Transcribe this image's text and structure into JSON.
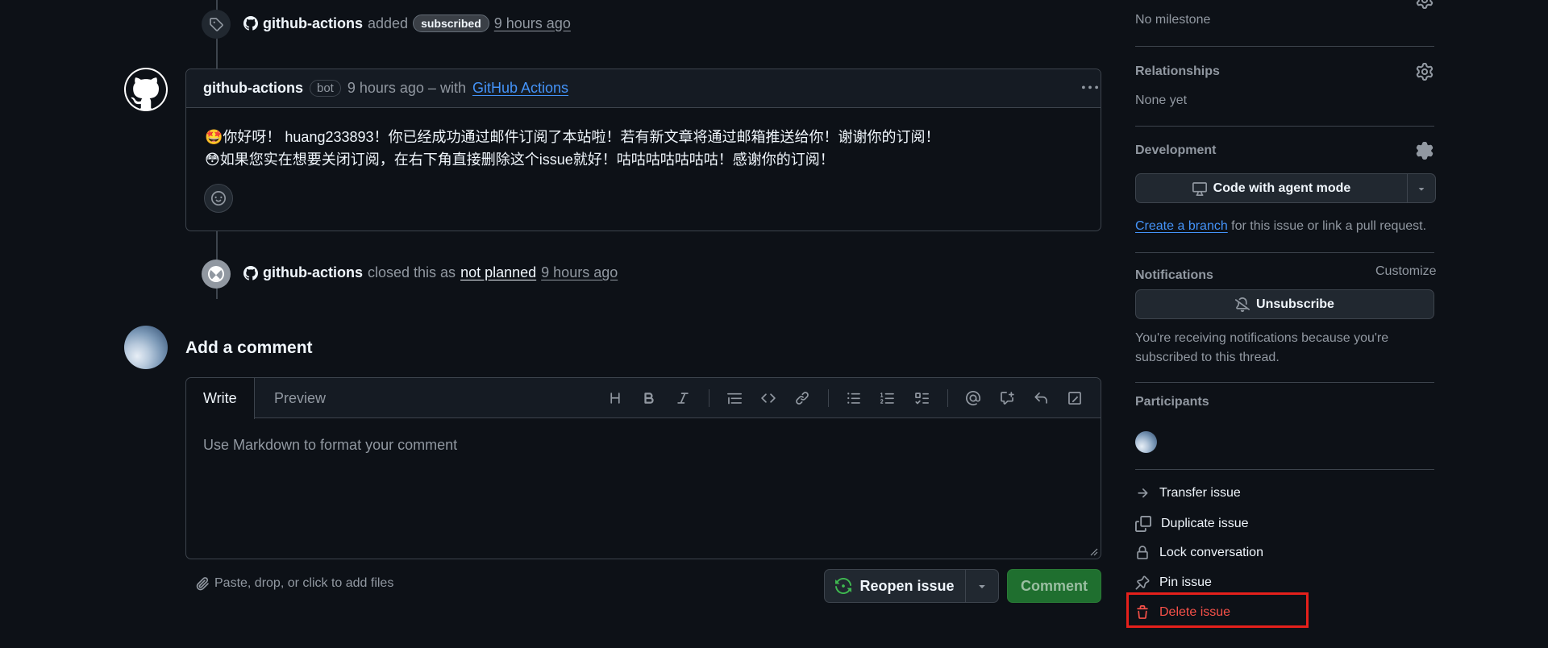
{
  "timeline": {
    "labeled_event": {
      "actor": "github-actions",
      "verb": "added",
      "label": "subscribed",
      "time": "9 hours ago"
    },
    "comment": {
      "author": "github-actions",
      "author_badge": "bot",
      "meta": "9 hours ago – with",
      "app_link": "GitHub Actions",
      "line1": "🤩你好呀！ huang233893！你已经成功通过邮件订阅了本站啦！若有新文章将通过邮箱推送给你！谢谢你的订阅！",
      "line2": "😳如果您实在想要关闭订阅，在右下角直接删除这个issue就好！咕咕咕咕咕咕咕！感谢你的订阅！"
    },
    "closed_event": {
      "actor": "github-actions",
      "verb": "closed this as",
      "reason": "not planned",
      "time": "9 hours ago"
    }
  },
  "add_comment": {
    "heading": "Add a comment",
    "tabs": [
      "Write",
      "Preview"
    ],
    "placeholder": "Use Markdown to format your comment",
    "attach_hint": "Paste, drop, or click to add files",
    "reopen_label": "Reopen issue",
    "comment_label": "Comment"
  },
  "sidebar": {
    "milestone_value": "No milestone",
    "relationships_title": "Relationships",
    "relationships_value": "None yet",
    "development_title": "Development",
    "agent_button": "Code with agent mode",
    "create_branch_link": "Create a branch",
    "create_branch_rest": " for this issue or link a pull request.",
    "notifications_title": "Notifications",
    "customize_label": "Customize",
    "unsubscribe_label": "Unsubscribe",
    "notif_text_1": "You're receiving notifications because you're",
    "notif_text_2": "subscribed to this thread.",
    "participants_title": "Participants",
    "actions": {
      "transfer": "Transfer issue",
      "duplicate": "Duplicate issue",
      "lock": "Lock conversation",
      "pin": "Pin issue",
      "delete": "Delete issue"
    }
  },
  "colors": {
    "background": "#0d1117",
    "link_blue": "#4493f8",
    "comment_green": "#1f6f2f",
    "danger_red": "#f85149",
    "highlight_box": "#e5201b"
  }
}
